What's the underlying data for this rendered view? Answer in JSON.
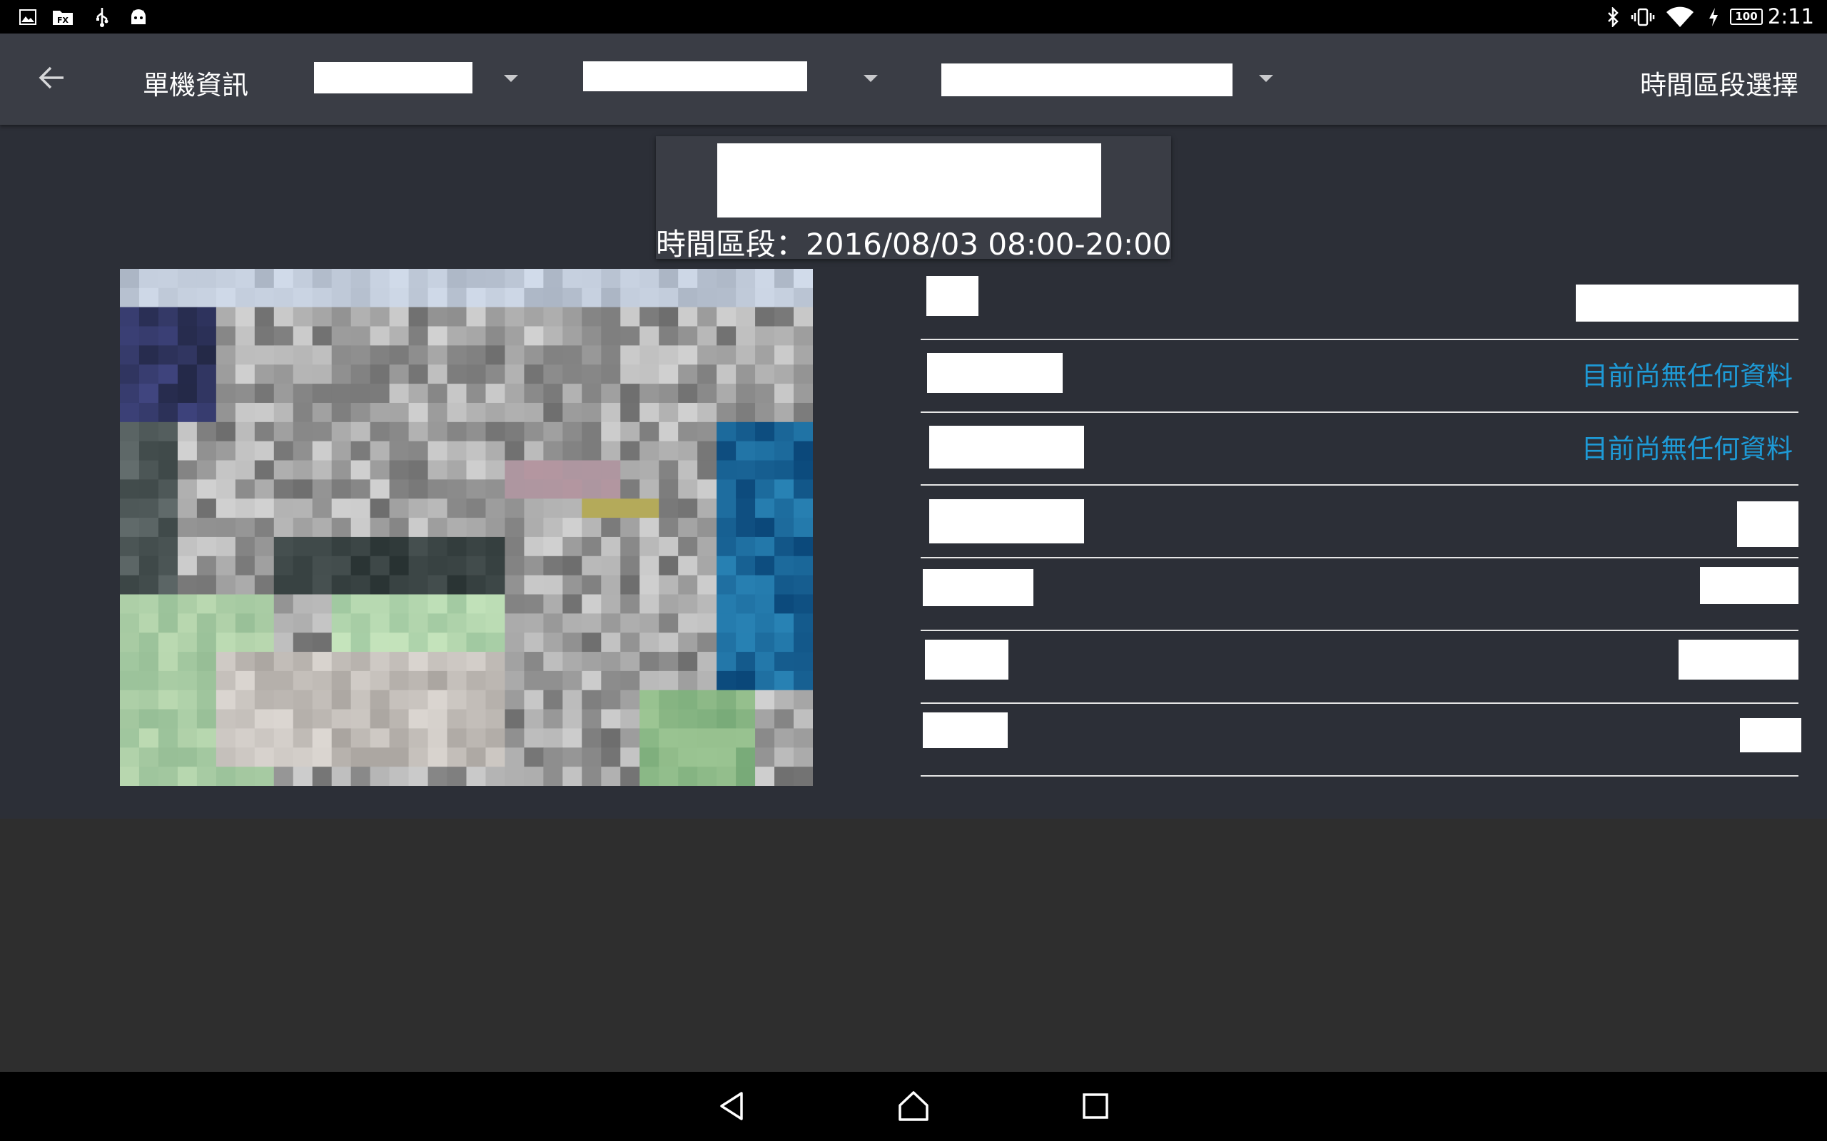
{
  "status_bar": {
    "time": "2:11",
    "battery": "100",
    "icons_left": [
      "gallery-icon",
      "file-icon",
      "usb-icon",
      "android-icon"
    ],
    "icons_right": [
      "bluetooth-icon",
      "vibrate-icon",
      "wifi-icon",
      "charging-icon",
      "battery-icon"
    ]
  },
  "action_bar": {
    "back_icon": "arrow-left-icon",
    "title": "單機資訊",
    "spinners": [
      {
        "value": "",
        "dropdown_icon": "triangle-down-icon"
      },
      {
        "value": "",
        "dropdown_icon": "triangle-down-icon"
      },
      {
        "value": "",
        "dropdown_icon": "triangle-down-icon"
      }
    ],
    "period_select": "時間區段選擇"
  },
  "header": {
    "name": "",
    "period_text": "時間區段：2016/08/03 08:00-20:00"
  },
  "info_rows": [
    {
      "label": "",
      "value": ""
    },
    {
      "label": "",
      "value": "目前尚無任何資料"
    },
    {
      "label": "",
      "value": "目前尚無任何資料"
    },
    {
      "label": "",
      "value": ""
    },
    {
      "label": "",
      "value": ""
    },
    {
      "label": "",
      "value": ""
    },
    {
      "label": "",
      "value": ""
    }
  ],
  "colors": {
    "status_bar": "#000000",
    "action_bar": "#3a3d45",
    "content_bg": "#2c2f37",
    "page_bg": "#2e2e2e",
    "accent_text": "#1e9ad6",
    "divider": "#e6e6e6"
  },
  "nav_bar": {
    "icons": [
      "back-triangle-icon",
      "home-icon",
      "recents-icon"
    ]
  }
}
